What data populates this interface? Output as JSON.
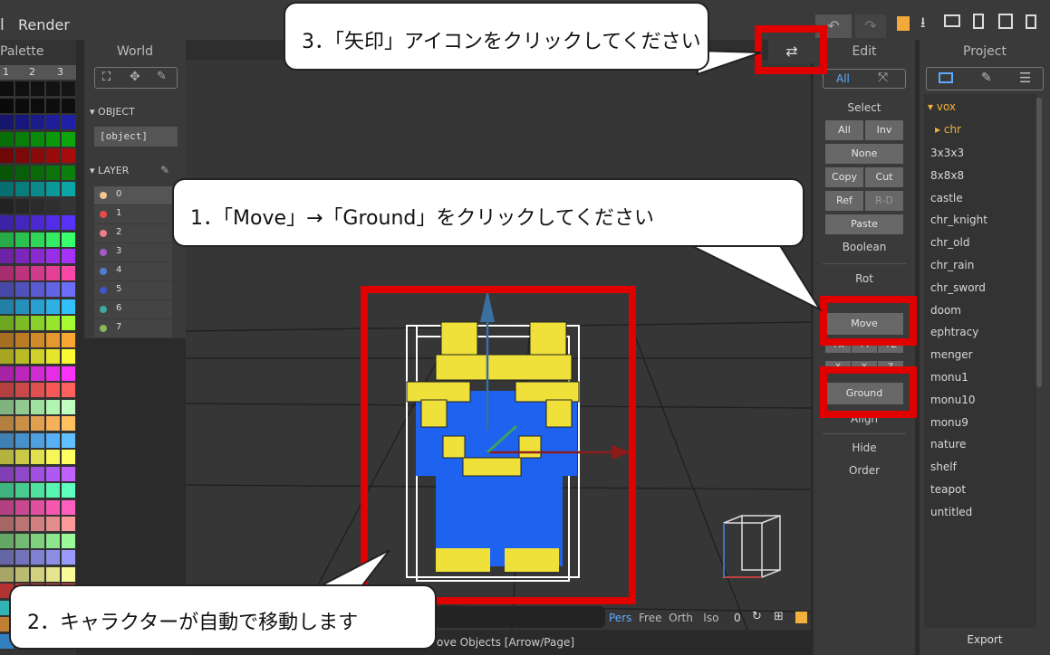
{
  "app": {
    "title_left": "l",
    "title_render": "Render"
  },
  "toolbar_right_icons": [
    "undo-icon",
    "redo-icon",
    "save-icon",
    "download-icon",
    "folder-open-icon",
    "new-file-icon",
    "copy-icon",
    "trash-icon"
  ],
  "palette": {
    "title": "Palette",
    "tabs": [
      "1",
      "2",
      "3"
    ]
  },
  "world": {
    "title": "World",
    "tools": [
      "select-icon",
      "move-icon",
      "eyedropper-icon"
    ],
    "object_label": "OBJECT",
    "object_value": "[object]",
    "layer_label": "LAYER",
    "layers": [
      {
        "name": "0",
        "color": "#f4c58f"
      },
      {
        "name": "1",
        "color": "#e94b4b"
      },
      {
        "name": "2",
        "color": "#f07c8b"
      },
      {
        "name": "3",
        "color": "#a45bc7"
      },
      {
        "name": "4",
        "color": "#4f7fd1"
      },
      {
        "name": "5",
        "color": "#3f55c9"
      },
      {
        "name": "6",
        "color": "#3fa9a0"
      },
      {
        "name": "7",
        "color": "#8ab856"
      }
    ]
  },
  "edit": {
    "title": "Edit",
    "mode_all": "All",
    "select_label": "Select",
    "select_all": "All",
    "select_inv": "Inv",
    "select_none": "None",
    "copy": "Copy",
    "cut": "Cut",
    "ref": "Ref",
    "rd": "R-D",
    "paste": "Paste",
    "boolean": "Boolean",
    "rot": "Rot",
    "move": "Move",
    "axis_plus": [
      "+X",
      "+Y",
      "+Z"
    ],
    "axis": [
      "X",
      "Y",
      "Z"
    ],
    "ground": "Ground",
    "align": "Align",
    "hide": "Hide",
    "order": "Order"
  },
  "project": {
    "title": "Project",
    "root": "vox",
    "sub": "chr",
    "items": [
      "3x3x3",
      "8x8x8",
      "castle",
      "chr_knight",
      "chr_old",
      "chr_rain",
      "chr_sword",
      "doom",
      "ephtracy",
      "menger",
      "monu1",
      "monu10",
      "monu9",
      "nature",
      "shelf",
      "teapot",
      "untitled"
    ],
    "export": "Export"
  },
  "viewport": {
    "modes": [
      "Pers",
      "Free",
      "Orth",
      "Iso"
    ],
    "zero": "0",
    "status": "ove Objects [Arrow/Page]",
    "swap_icon": "swap-arrows-icon",
    "swap_glyph": "⇄"
  },
  "callouts": {
    "step1": "1．「Move」→「Ground」をクリックしてください",
    "step2": "2．キャラクターが自動で移動します",
    "step3": "3．「矢印」アイコンをクリックしてください"
  },
  "colors": {
    "accent": "#f2b13c",
    "highlight": "#e00000"
  }
}
